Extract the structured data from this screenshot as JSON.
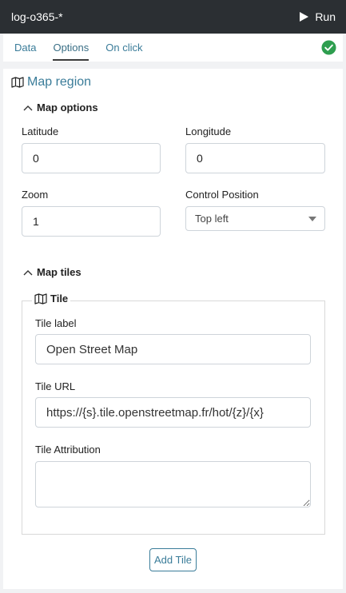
{
  "app": {
    "title": "log-o365-*",
    "run_label": "Run"
  },
  "tabs": [
    {
      "label": "Data"
    },
    {
      "label": "Options"
    },
    {
      "label": "On click"
    }
  ],
  "region": {
    "title": "Map region"
  },
  "map_options": {
    "header": "Map options",
    "latitude": {
      "label": "Latitude",
      "value": "0"
    },
    "longitude": {
      "label": "Longitude",
      "value": "0"
    },
    "zoom": {
      "label": "Zoom",
      "value": "1"
    },
    "control_position": {
      "label": "Control Position",
      "selected": "Top left"
    }
  },
  "map_tiles": {
    "header": "Map tiles",
    "tile": {
      "legend": "Tile",
      "label_field": {
        "label": "Tile label",
        "value": "Open Street Map"
      },
      "url_field": {
        "label": "Tile URL",
        "value": "https://{s}.tile.openstreetmap.fr/hot/{z}/{x}"
      },
      "attribution_field": {
        "label": "Tile Attribution",
        "value": ""
      }
    },
    "add_tile_label": "Add Tile"
  },
  "colors": {
    "accent": "#3a7c99",
    "success": "#2e9e4f",
    "topbar": "#2b2f33"
  },
  "icons": {
    "run": "play-icon",
    "status": "check-circle-icon",
    "region": "map-icon",
    "collapse": "chevron-up-icon"
  }
}
